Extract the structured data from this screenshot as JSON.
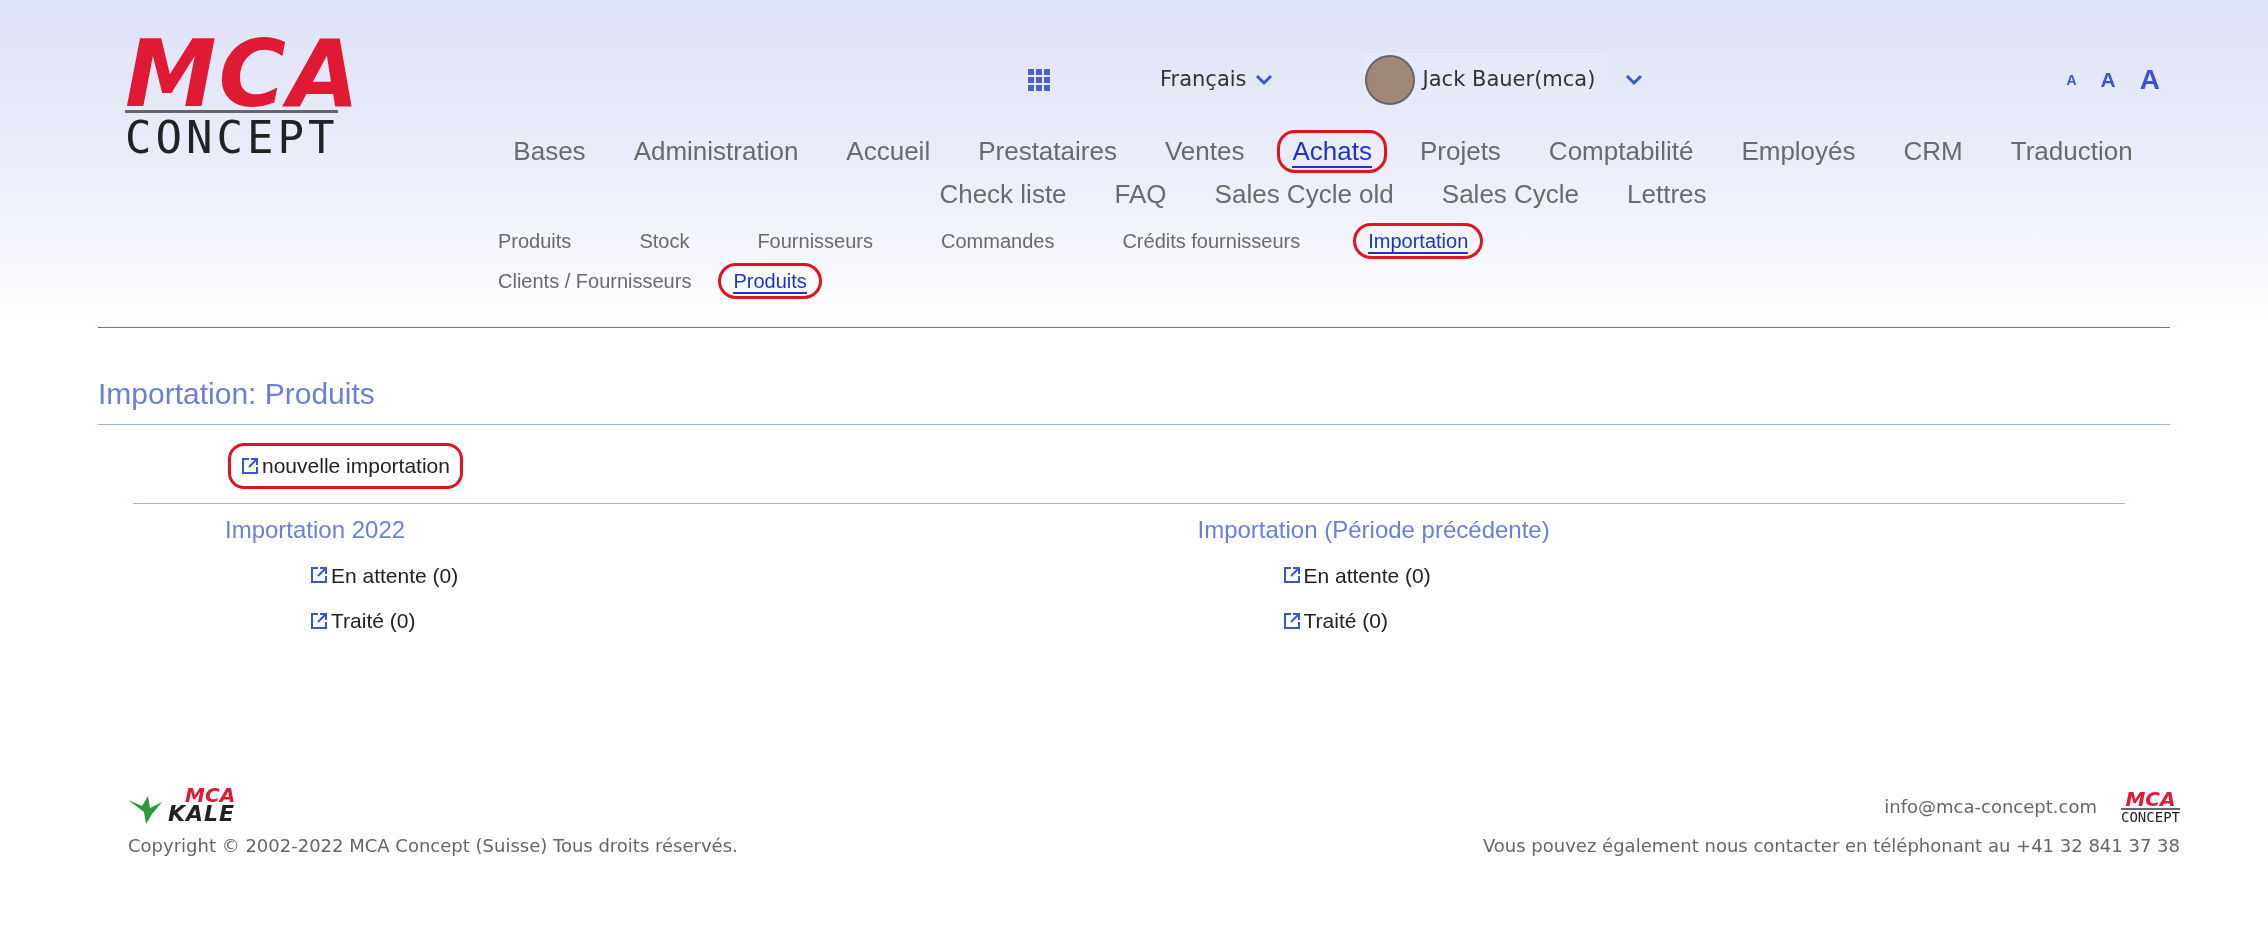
{
  "logo": {
    "top": "MCA",
    "bottom": "CONCEPT"
  },
  "topbar": {
    "language": "Français",
    "user": "Jack Bauer",
    "user_suffix": "(mca)",
    "font_sizes": [
      "A",
      "A",
      "A"
    ]
  },
  "main_nav": [
    {
      "label": "Bases",
      "selected": false,
      "highlighted": false
    },
    {
      "label": "Administration",
      "selected": false,
      "highlighted": false
    },
    {
      "label": "Accueil",
      "selected": false,
      "highlighted": false
    },
    {
      "label": "Prestataires",
      "selected": false,
      "highlighted": false
    },
    {
      "label": "Ventes",
      "selected": false,
      "highlighted": false
    },
    {
      "label": "Achats",
      "selected": true,
      "highlighted": true
    },
    {
      "label": "Projets",
      "selected": false,
      "highlighted": false
    },
    {
      "label": "Comptabilité",
      "selected": false,
      "highlighted": false
    },
    {
      "label": "Employés",
      "selected": false,
      "highlighted": false
    },
    {
      "label": "CRM",
      "selected": false,
      "highlighted": false
    },
    {
      "label": "Traduction",
      "selected": false,
      "highlighted": false
    },
    {
      "label": "Check liste",
      "selected": false,
      "highlighted": false
    },
    {
      "label": "FAQ",
      "selected": false,
      "highlighted": false
    },
    {
      "label": "Sales Cycle old",
      "selected": false,
      "highlighted": false
    },
    {
      "label": "Sales Cycle",
      "selected": false,
      "highlighted": false
    },
    {
      "label": "Lettres",
      "selected": false,
      "highlighted": false
    }
  ],
  "sub_nav": [
    {
      "label": "Produits",
      "selected": false,
      "highlighted": false
    },
    {
      "label": "Stock",
      "selected": false,
      "highlighted": false
    },
    {
      "label": "Fournisseurs",
      "selected": false,
      "highlighted": false
    },
    {
      "label": "Commandes",
      "selected": false,
      "highlighted": false
    },
    {
      "label": "Crédits fournisseurs",
      "selected": false,
      "highlighted": false
    },
    {
      "label": "Importation",
      "selected": true,
      "highlighted": true
    }
  ],
  "third_nav": [
    {
      "label": "Clients / Fournisseurs",
      "selected": false,
      "highlighted": false
    },
    {
      "label": "Produits",
      "selected": true,
      "highlighted": true
    }
  ],
  "page_title": "Importation: Produits",
  "new_import": {
    "label": "nouvelle importation",
    "highlighted": true
  },
  "sections": [
    {
      "title": "Importation 2022",
      "links": [
        "En attente (0)",
        "Traité (0)"
      ]
    },
    {
      "title": "Importation (Période précédente)",
      "links": [
        "En attente (0)",
        "Traité (0)"
      ]
    }
  ],
  "footer": {
    "kale_logo": {
      "top": "MCA",
      "bottom": "KALE"
    },
    "copyright": "Copyright © 2002-2022 MCA Concept (Suisse) Tous droits réservés.",
    "email": "info@mca-concept.com",
    "logo": {
      "top": "MCA",
      "bottom": "CONCEPT"
    },
    "phone": "Vous pouvez également nous contacter en téléphonant au +41 32 841 37 38"
  }
}
